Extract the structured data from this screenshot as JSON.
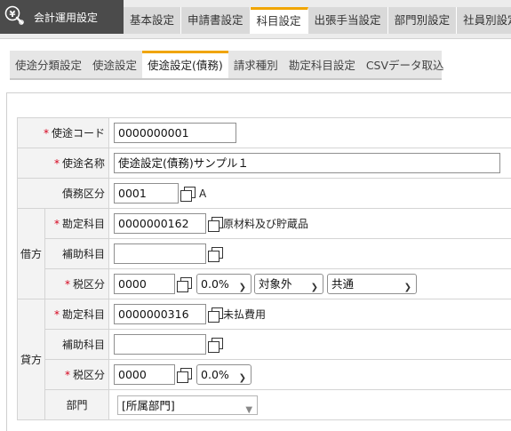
{
  "app": {
    "title": "会計運用設定"
  },
  "main_tabs": [
    {
      "label": "基本設定",
      "active": false
    },
    {
      "label": "申請書設定",
      "active": false
    },
    {
      "label": "科目設定",
      "active": true
    },
    {
      "label": "出張手当設定",
      "active": false
    },
    {
      "label": "部門別設定",
      "active": false
    },
    {
      "label": "社員別設定",
      "active": false
    }
  ],
  "sub_tabs": [
    {
      "label": "使途分類設定",
      "active": false
    },
    {
      "label": "使途設定",
      "active": false
    },
    {
      "label": "使途設定(債務)",
      "active": true
    },
    {
      "label": "請求種別",
      "active": false
    },
    {
      "label": "勘定科目設定",
      "active": false
    },
    {
      "label": "CSVデータ取込",
      "active": false
    }
  ],
  "required_mark": "*",
  "form": {
    "code": {
      "label": "使途コード",
      "value": "0000000001"
    },
    "name": {
      "label": "使途名称",
      "value": "使途設定(債務)サンプル１"
    },
    "debt_class": {
      "label": "債務区分",
      "value": "0001",
      "display": "A"
    },
    "debit": {
      "group_label": "借方",
      "account": {
        "label": "勘定科目",
        "value": "0000000162",
        "display": "原材料及び貯蔵品"
      },
      "sub_account": {
        "label": "補助科目",
        "value": ""
      },
      "tax": {
        "label": "税区分",
        "value": "0000",
        "rate": "0.0%",
        "type": "対象外",
        "scope": "共通"
      }
    },
    "credit": {
      "group_label": "貸方",
      "account": {
        "label": "勘定科目",
        "value": "0000000316",
        "display": "未払費用"
      },
      "sub_account": {
        "label": "補助科目",
        "value": ""
      },
      "tax": {
        "label": "税区分",
        "value": "0000",
        "rate": "0.0%"
      },
      "department": {
        "label": "部門",
        "value": "[所属部門]"
      }
    }
  },
  "colors": {
    "accent": "#f0a500",
    "required": "#d6001c",
    "app_header": "#4b4b4b"
  }
}
